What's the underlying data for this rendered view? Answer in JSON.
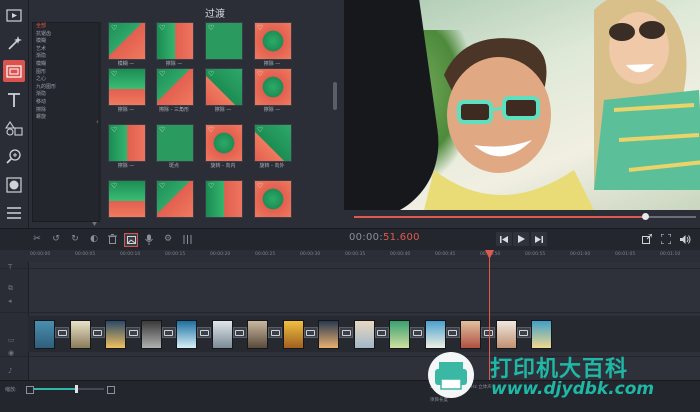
{
  "transitions_panel": {
    "title": "过渡",
    "categories": [
      "全部",
      "抗锯齿",
      "模糊",
      "艺术",
      "渐隐",
      "模糊",
      "图形",
      "之心",
      "九的图形",
      "渐隐",
      "移动",
      "擦除",
      "螺旋"
    ],
    "selected_category_index": 0,
    "tiles": [
      {
        "label": "模糊 —"
      },
      {
        "label": "擦除 —"
      },
      {
        "label": ""
      },
      {
        "label": "擦除 —"
      },
      {
        "label": "擦除 —"
      },
      {
        "label": "擦除 - 三角形"
      },
      {
        "label": "擦除 —"
      },
      {
        "label": "擦除 —"
      },
      {
        "label": "擦除 —"
      },
      {
        "label": "斑点"
      },
      {
        "label": "旋转 - 向内"
      },
      {
        "label": "旋转 - 向外"
      },
      {
        "label": ""
      },
      {
        "label": ""
      },
      {
        "label": ""
      },
      {
        "label": ""
      }
    ]
  },
  "player": {
    "timecode_prefix": "00:00:",
    "timecode_active": "51.600",
    "progress": 0.85
  },
  "ruler": {
    "ticks": [
      "00:00:00",
      "00:00:05",
      "00:00:10",
      "00:00:15",
      "00:00:20",
      "00:00:25",
      "00:00:30",
      "00:00:35",
      "00:00:40",
      "00:00:45",
      "00:00:50",
      "00:00:55",
      "00:01:00",
      "00:01:05",
      "00:01:10"
    ]
  },
  "timeline": {
    "clip_count": 15
  },
  "bottom": {
    "zoom_label": "缩放:",
    "zoom_level": 0.6,
    "file_info_1": "29.97 FPS, 44100 Hz 立体声",
    "file_info_2": "项目长度"
  },
  "watermark": {
    "title": "打印机大百科",
    "url": "www.djydbk.com"
  },
  "icons": [
    "video-icon",
    "magic-wand-icon",
    "transition-icon",
    "text-icon",
    "shapes-icon",
    "zoom-icon",
    "filter-icon",
    "menu-icon",
    "undo-icon",
    "redo-icon",
    "cut-icon",
    "color-icon",
    "delete-icon",
    "image-icon",
    "mic-icon",
    "gear-icon",
    "equalizer-icon",
    "prev-icon",
    "play-icon",
    "next-icon",
    "export-icon",
    "fullscreen-icon",
    "volume-icon"
  ]
}
